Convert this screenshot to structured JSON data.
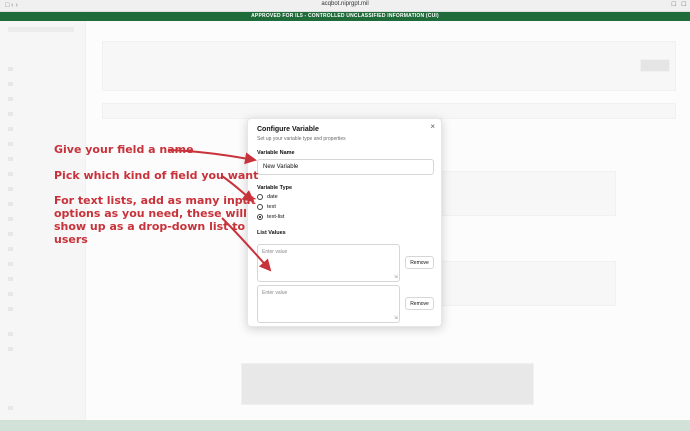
{
  "browser": {
    "url": "acqbot.niprgpt.mil",
    "banner": "APPROVED FOR IL5 - CONTROLLED UNCLASSIFIED INFORMATION (CUI)"
  },
  "colors": {
    "banner": "#1f6b3a",
    "annotation": "#c8323a"
  },
  "modal": {
    "title": "Configure Variable",
    "subtitle": "Set up your variable type and properties",
    "close_icon": "close-icon",
    "variable_name": {
      "label": "Variable Name",
      "value": "New Variable"
    },
    "variable_type": {
      "label": "Variable Type",
      "options": [
        {
          "label": "date",
          "selected": false
        },
        {
          "label": "text",
          "selected": false
        },
        {
          "label": "text-list",
          "selected": true
        }
      ]
    },
    "list_values": {
      "label": "List Values",
      "items": [
        {
          "placeholder": "Enter value",
          "remove_label": "Remove"
        },
        {
          "placeholder": "Enter value",
          "remove_label": "Remove"
        }
      ]
    }
  },
  "annotations": {
    "name": "Give your field a name",
    "kind": "Pick which kind of field you want",
    "list_1": "For text lists, add as many input",
    "list_2": "options as you need, these will",
    "list_3": "show up as a  drop-down list to",
    "list_4": "users"
  }
}
